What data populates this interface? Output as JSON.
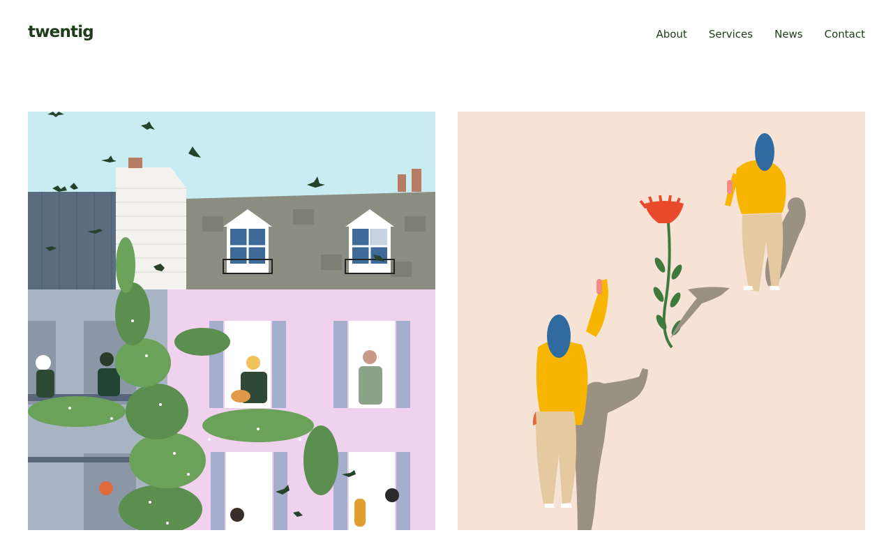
{
  "site": {
    "logo": "twentig"
  },
  "nav": {
    "items": [
      {
        "label": "About"
      },
      {
        "label": "Services"
      },
      {
        "label": "News"
      },
      {
        "label": "Contact"
      }
    ]
  },
  "colors": {
    "brand_green": "#1e3b1a",
    "sky": "#c9ecf3",
    "pink_facade": "#f1d2ee",
    "peach_background": "#f6e3d6",
    "mustard": "#f7b500",
    "hair_blue": "#2f6ba1"
  },
  "gallery": [
    {
      "name": "apartment-building-illustration"
    },
    {
      "name": "two-people-waving-illustration"
    }
  ]
}
